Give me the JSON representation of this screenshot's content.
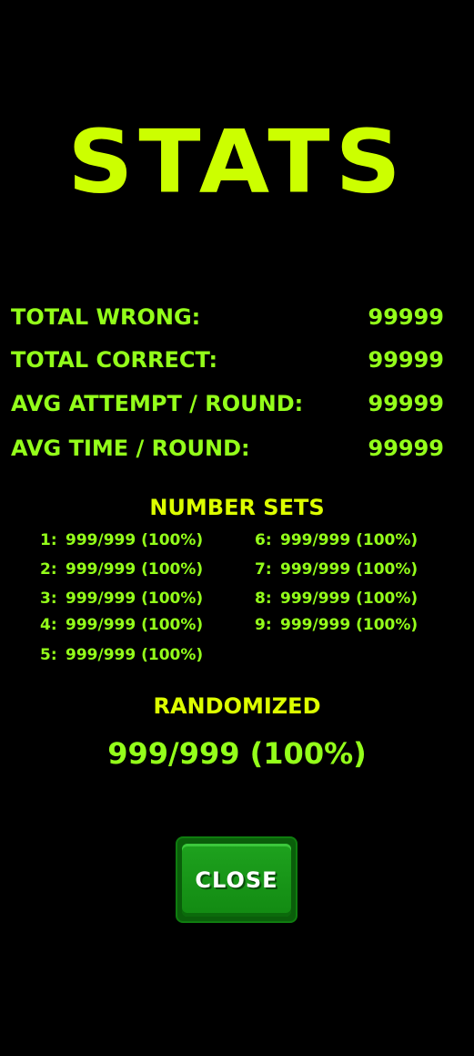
{
  "screen": {
    "title": "STATS"
  },
  "stats": [
    {
      "label": "TOTAL WRONG:",
      "value": "99999"
    },
    {
      "label": "TOTAL CORRECT:",
      "value": "99999"
    },
    {
      "label": "AVG ATTEMPT / ROUND:",
      "value": "99999"
    },
    {
      "label": "AVG TIME / ROUND:",
      "value": "99999"
    }
  ],
  "number_sets": {
    "title": "NUMBER SETS",
    "items": [
      {
        "num": "1:",
        "value": "999/999 (100%)"
      },
      {
        "num": "2:",
        "value": "999/999 (100%)"
      },
      {
        "num": "3:",
        "value": "999/999 (100%)"
      },
      {
        "num": "4:",
        "value": "999/999 (100%)"
      },
      {
        "num": "5:",
        "value": "999/999 (100%)"
      },
      {
        "num": "6:",
        "value": "999/999 (100%)"
      },
      {
        "num": "7:",
        "value": "999/999 (100%)"
      },
      {
        "num": "8:",
        "value": "999/999 (100%)"
      },
      {
        "num": "9:",
        "value": "999/999 (100%)"
      }
    ]
  },
  "randomized": {
    "title": "RANDOMIZED",
    "value": "999/999 (100%)"
  },
  "close_button": {
    "label": "CLOSE"
  },
  "colors": {
    "background": "#000000",
    "title": "#ccff00",
    "text": "#94ff1a",
    "section_title": "#ddff00",
    "button": "#128a12"
  }
}
